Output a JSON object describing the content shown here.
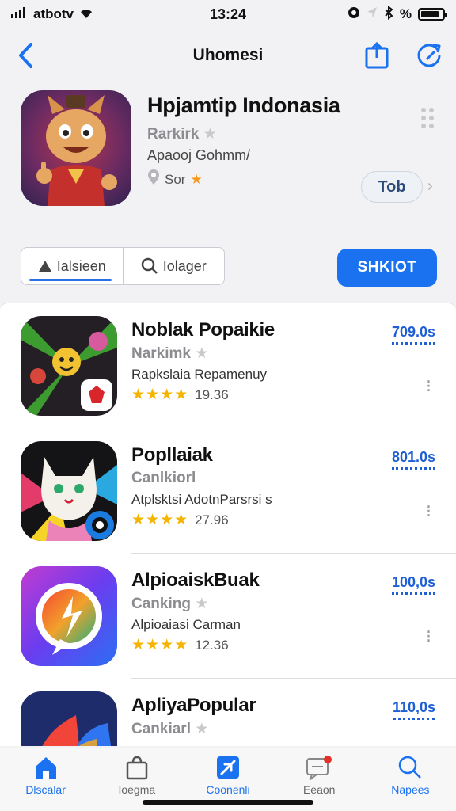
{
  "status_bar": {
    "carrier": "atbotv",
    "time": "13:24",
    "battery_percent_label": "%",
    "battery_level": 0.85
  },
  "nav": {
    "title": "Uhomesi"
  },
  "featured": {
    "name": "Hpjamtip Indonasia",
    "rank": "Rarkirk",
    "developer": "Apaooj Gohmm/",
    "meta": "Sor",
    "get_label": "Tob"
  },
  "segments": [
    {
      "label": "Ialsieen"
    },
    {
      "label": "Iolager"
    }
  ],
  "action_label": "SHKIOT",
  "apps": [
    {
      "name": "Noblak Popaikie",
      "category": "Narkimk",
      "developer": "Rapkslaia Repamenuy",
      "stars": "★★★★",
      "rating": "19.36",
      "price": "709.0s"
    },
    {
      "name": "Popllaiak",
      "category": "Canlkiorl",
      "developer": "Atplsktsi AdotnParsrsi s",
      "stars": "★★★★",
      "rating": "27.96",
      "price": "801.0s"
    },
    {
      "name": "AlpioaiskBuak",
      "category": "Canking",
      "developer": "Alpioaiasi Carman",
      "stars": "★★★★",
      "rating": "12.36",
      "price": "100,0s"
    },
    {
      "name": "ApliyaPopular",
      "category": "Cankiarl",
      "developer": "",
      "stars": "",
      "rating": "",
      "price": "110,0s"
    }
  ],
  "tabs": [
    {
      "label": "Dlscalar",
      "icon": "home-icon"
    },
    {
      "label": "Ioegma",
      "icon": "bag-icon"
    },
    {
      "label": "Coonenli",
      "icon": "plane-icon"
    },
    {
      "label": "Eeaon",
      "icon": "message-icon"
    },
    {
      "label": "Napees",
      "icon": "search-icon"
    }
  ],
  "colors": {
    "accent": "#1a72f0",
    "star": "#f5b400",
    "price": "#1f5fd6"
  }
}
